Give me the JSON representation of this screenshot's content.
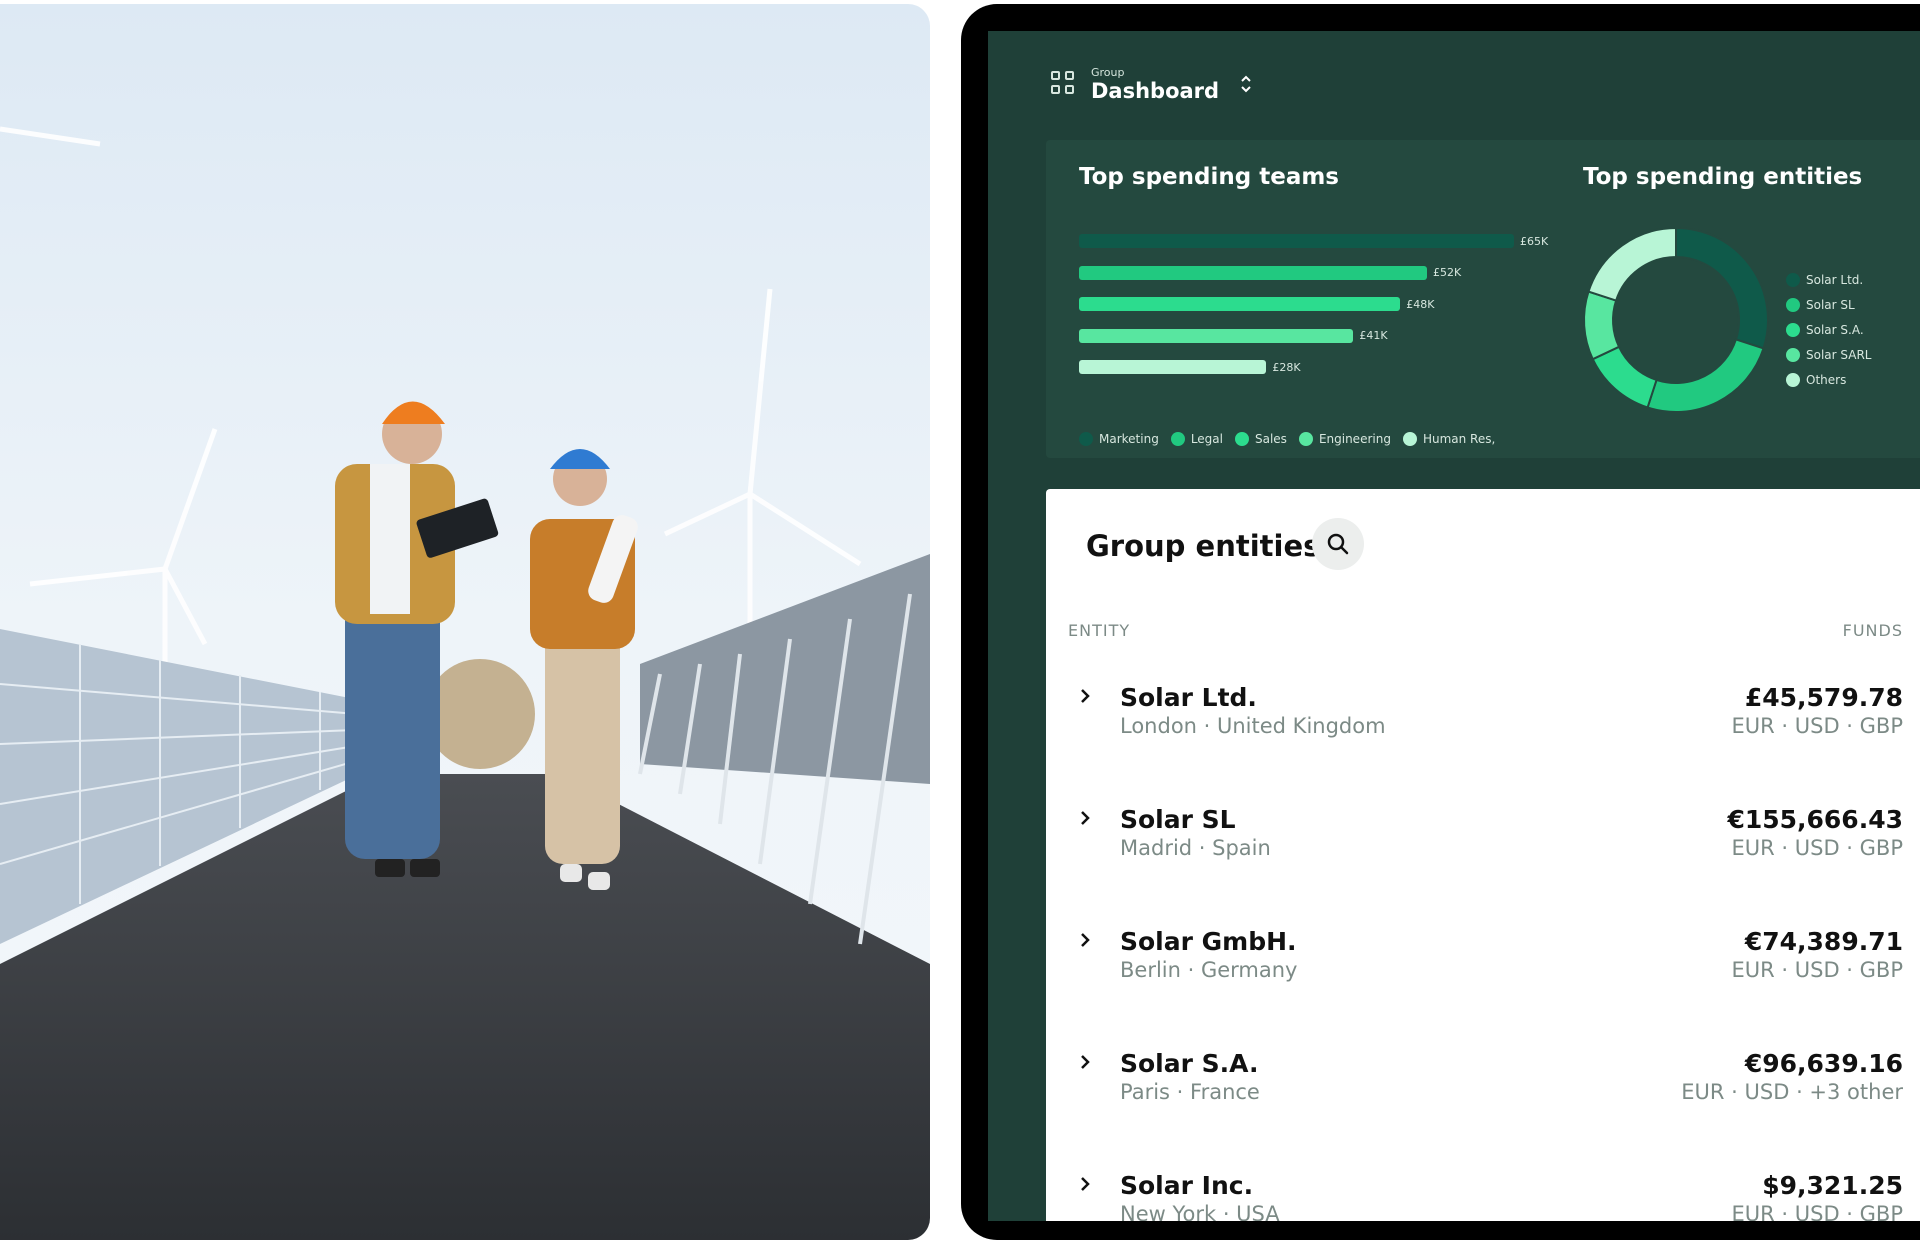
{
  "header": {
    "breadcrumb_small": "Group",
    "title": "Dashboard"
  },
  "charts_panel": {
    "teams_title": "Top spending teams",
    "entities_title": "Top spending entities"
  },
  "chart_data": [
    {
      "type": "bar",
      "title": "Top spending teams",
      "categories": [
        "Marketing",
        "Legal",
        "Sales",
        "Engineering",
        "Human Res,"
      ],
      "values": [
        65,
        52,
        48,
        41,
        28
      ],
      "value_labels": [
        "£65K",
        "£52K",
        "£48K",
        "£41K",
        "£28K"
      ],
      "colors": [
        "#0f5a4a",
        "#21c980",
        "#2cdc8e",
        "#58e6a0",
        "#b8f5d6"
      ],
      "legend_placement": "bottom"
    },
    {
      "type": "pie",
      "title": "Top spending entities",
      "categories": [
        "Solar Ltd.",
        "Solar SL",
        "Solar S.A.",
        "Solar SARL",
        "Others"
      ],
      "values": [
        30,
        25,
        13,
        12,
        20
      ],
      "colors": [
        "#0f5a4a",
        "#21c980",
        "#2cdc8e",
        "#58e6a0",
        "#b8f5d6"
      ],
      "legend_placement": "right"
    }
  ],
  "entities_card": {
    "title": "Group entities",
    "search_icon": "search-icon",
    "col_entity": "ENTITY",
    "col_funds": "FUNDS",
    "rows": [
      {
        "name": "Solar Ltd.",
        "location": "London · United Kingdom",
        "amount": "£45,579.78",
        "currencies": "EUR · USD · GBP"
      },
      {
        "name": "Solar SL",
        "location": "Madrid · Spain",
        "amount": "€155,666.43",
        "currencies": "EUR · USD · GBP"
      },
      {
        "name": "Solar GmbH.",
        "location": "Berlin · Germany",
        "amount": "€74,389.71",
        "currencies": "EUR · USD · GBP"
      },
      {
        "name": "Solar S.A.",
        "location": "Paris · France",
        "amount": "€96,639.16",
        "currencies": "EUR · USD · +3 other"
      },
      {
        "name": "Solar Inc.",
        "location": "New York · USA",
        "amount": "$9,321.25",
        "currencies": "EUR · USD · GBP"
      }
    ]
  },
  "colors": {
    "screen_bg": "#1f4038",
    "panel_bg": "#24493f",
    "accent": "#21c980"
  }
}
